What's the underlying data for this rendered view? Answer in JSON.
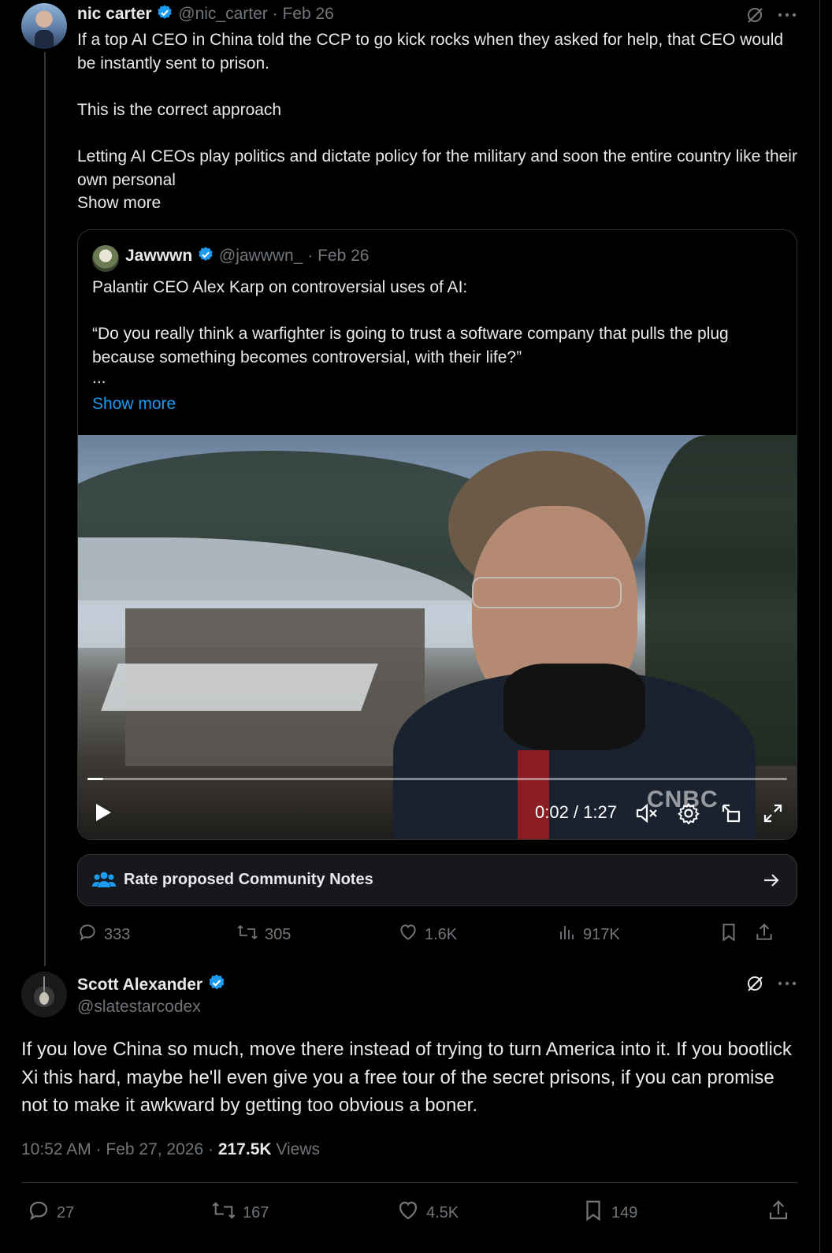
{
  "tweet1": {
    "name": "nic carter",
    "handle": "@nic_carter",
    "date": "· Feb 26",
    "paragraphs": [
      "If a top AI CEO in China told the CCP to go kick rocks when they asked for help, that CEO would be instantly sent to prison.",
      "This is the correct approach",
      "Letting AI CEOs play politics and dictate policy for the military and soon the entire country like their own personal"
    ],
    "show_more": "Show more",
    "quote": {
      "name": "Jawwwn",
      "handle": "@jawwwn_",
      "date": "· Feb 26",
      "paragraphs": [
        "Palantir CEO Alex Karp on controversial uses of AI:",
        "“Do you really think a warfighter is going to trust a software company that pulls the plug because something becomes controversial, with their life?”",
        "..."
      ],
      "show_more": "Show more",
      "video": {
        "time": "0:02 / 1:27",
        "watermark": "CNBC",
        "progress": 0.023
      }
    },
    "community_notes": "Rate proposed Community Notes",
    "stats": {
      "replies": "333",
      "reposts": "305",
      "likes": "1.6K",
      "views": "917K"
    }
  },
  "tweet2": {
    "name": "Scott Alexander",
    "handle": "@slatestarcodex",
    "body": "If you love China so much, move there instead of trying to turn America into it. If you bootlick Xi this hard, maybe he'll even give you a free tour of the secret prisons, if you can promise not to make it awkward by getting too obvious a boner.",
    "time": "10:52 AM · Feb 27, 2026 · ",
    "views_count": "217.5K",
    "views_label": "Views",
    "stats": {
      "replies": "27",
      "reposts": "167",
      "likes": "4.5K",
      "bookmarks": "149"
    }
  },
  "colors": {
    "accent": "#1d9bf0",
    "muted": "#71767b",
    "text": "#e7e9ea",
    "background": "#000000"
  }
}
